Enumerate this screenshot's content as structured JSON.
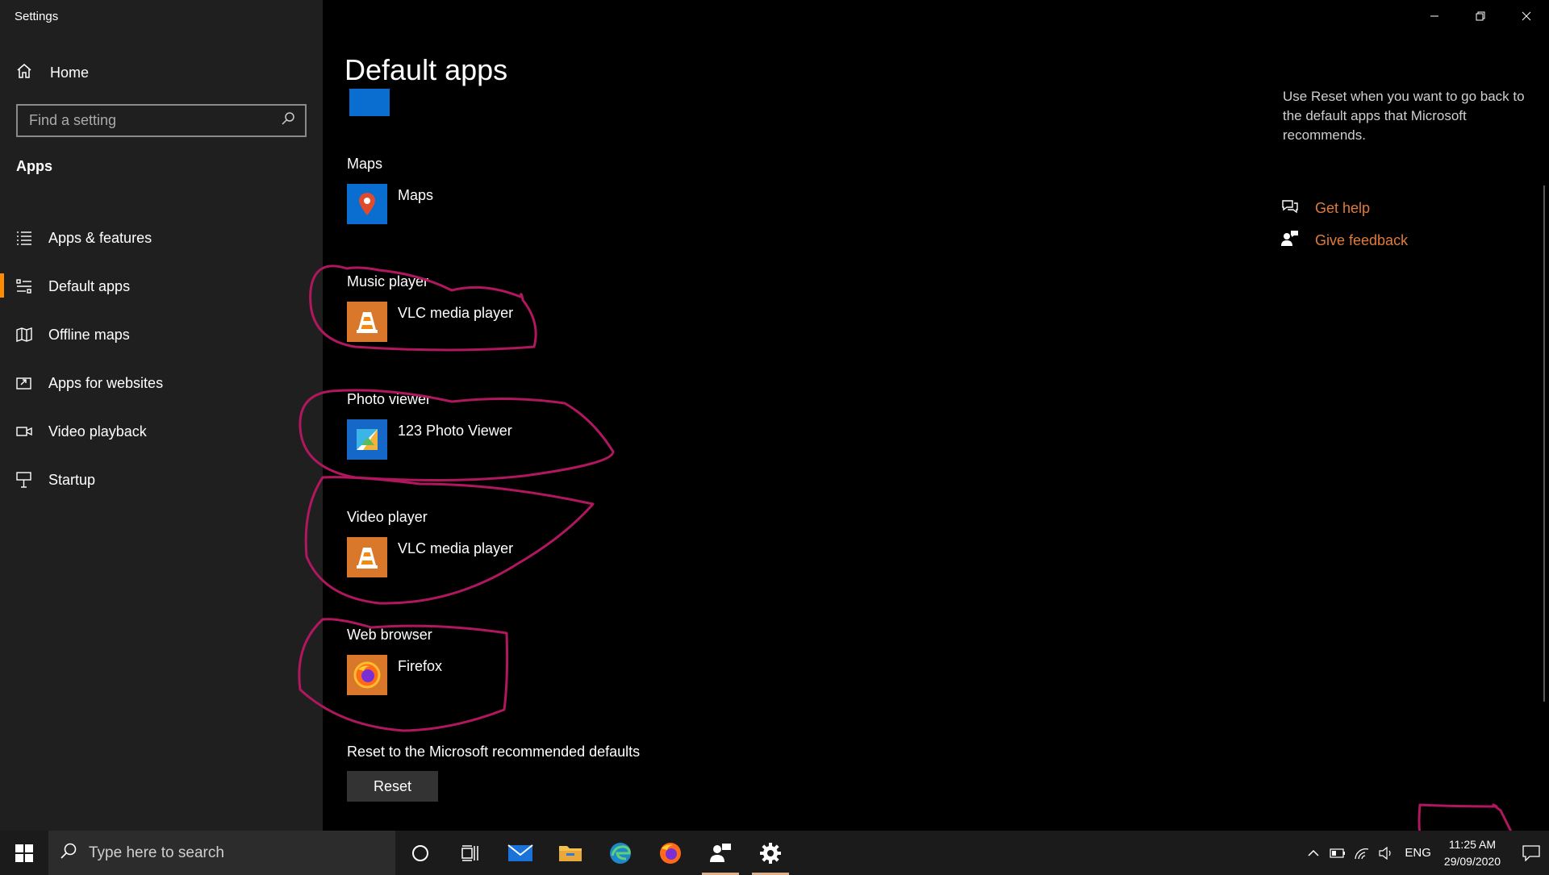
{
  "window": {
    "title": "Settings"
  },
  "sidebar": {
    "home_label": "Home",
    "search_placeholder": "Find a setting",
    "section_title": "Apps",
    "items": [
      {
        "label": "Apps & features",
        "icon": "list-icon"
      },
      {
        "label": "Default apps",
        "icon": "default-apps-icon",
        "active": true
      },
      {
        "label": "Offline maps",
        "icon": "map-icon"
      },
      {
        "label": "Apps for websites",
        "icon": "external-link-icon"
      },
      {
        "label": "Video playback",
        "icon": "video-icon"
      },
      {
        "label": "Startup",
        "icon": "startup-icon"
      }
    ]
  },
  "main": {
    "title": "Default apps",
    "categories": [
      {
        "label": "Maps",
        "app": "Maps"
      },
      {
        "label": "Music player",
        "app": "VLC media player"
      },
      {
        "label": "Photo viewer",
        "app": "123 Photo Viewer"
      },
      {
        "label": "Video player",
        "app": "VLC media player"
      },
      {
        "label": "Web browser",
        "app": "Firefox"
      }
    ],
    "reset_label": "Reset to the Microsoft recommended defaults",
    "reset_button": "Reset"
  },
  "right": {
    "description": "Use Reset when you want to go back to the default apps that Microsoft recommends.",
    "get_help": "Get help",
    "give_feedback": "Give feedback"
  },
  "taskbar": {
    "search_placeholder": "Type here to search",
    "language": "ENG",
    "time": "11:25 AM",
    "date": "29/09/2020"
  },
  "colors": {
    "accent": "#ff8c00",
    "link": "#e07b3a",
    "annotation": "#b0175f",
    "sidebar_bg": "#1f1f1f"
  }
}
